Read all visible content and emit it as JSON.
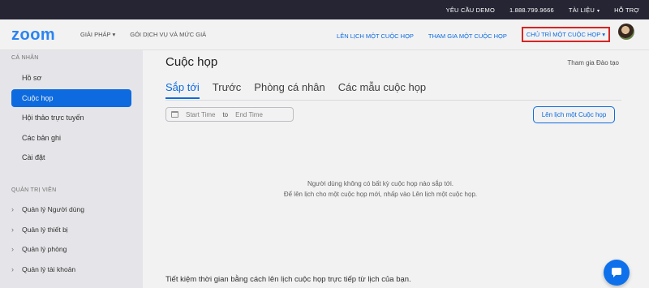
{
  "topbar": {
    "demo": "YÊU CẦU DEMO",
    "phone": "1.888.799.9666",
    "resources": "TÀI LIỆU",
    "support": "HỖ TRỢ",
    "caret": "▾"
  },
  "navbar": {
    "logo": "zoom",
    "solutions": "GIẢI PHÁP",
    "plans": "GÓI DỊCH VỤ VÀ MỨC GIÁ",
    "schedule": "LÊN LỊCH MỘT CUỘC HỌP",
    "join": "THAM GIA MỘT CUỘC HỌP",
    "host": "CHỦ TRÌ MỘT CUỘC HỌP",
    "caret": "▾"
  },
  "sidebar": {
    "personal_title": "CÁ NHÂN",
    "personal_items": [
      "Hồ sơ",
      "Cuộc họp",
      "Hội thảo trực tuyến",
      "Các bản ghi",
      "Cài đặt"
    ],
    "admin_title": "QUẢN TRỊ VIÊN",
    "admin_items": [
      "Quản lý Người dùng",
      "Quản lý thiết bị",
      "Quản lý phòng",
      "Quản lý tài khoản"
    ],
    "arrow": "›"
  },
  "main": {
    "title": "Cuộc họp",
    "training": "Tham gia Đào tạo",
    "tabs": [
      "Sắp tới",
      "Trước",
      "Phòng cá nhân",
      "Các mẫu cuộc họp"
    ],
    "start_time": "Start Time",
    "to": "to",
    "end_time": "End Time",
    "schedule_button": "Lên lịch một Cuộc họp",
    "empty_line1": "Người dùng không có bất kỳ cuộc họp nào sắp tới.",
    "empty_line2": "Để lên lịch cho một cuộc họp mới, nhấp vào Lên lịch một cuộc họp.",
    "bottom_text": "Tiết kiệm thời gian bằng cách lên lịch cuộc họp trực tiếp từ lịch của bạn."
  },
  "colors": {
    "accent": "#0E71EB",
    "topbar": "#252534",
    "highlight": "#e02828"
  },
  "icons": [
    "calendar-icon",
    "chat-icon",
    "chevron-right-icon",
    "caret-down-icon"
  ]
}
